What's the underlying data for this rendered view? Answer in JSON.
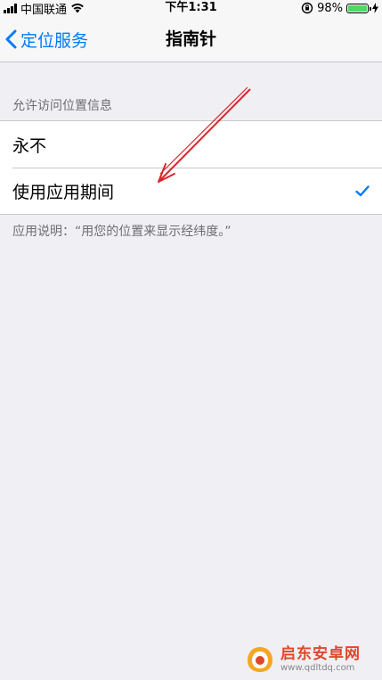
{
  "status_bar": {
    "carrier": "中国联通",
    "time": "下午1:31",
    "battery_percent_label": "98%",
    "battery_level": 0.98
  },
  "nav": {
    "back_label": "定位服务",
    "title": "指南针"
  },
  "section": {
    "header": "允许访问位置信息",
    "options": [
      {
        "label": "永不",
        "selected": false
      },
      {
        "label": "使用应用期间",
        "selected": true
      }
    ],
    "footer": "应用说明：“用您的位置来显示经纬度。”"
  },
  "watermark": {
    "name": "启东安卓网",
    "url": "www.qdltdq.com"
  },
  "colors": {
    "accent": "#007aff",
    "background": "#efeff4",
    "battery": "#4cd964",
    "annotation": "#d9252a"
  }
}
